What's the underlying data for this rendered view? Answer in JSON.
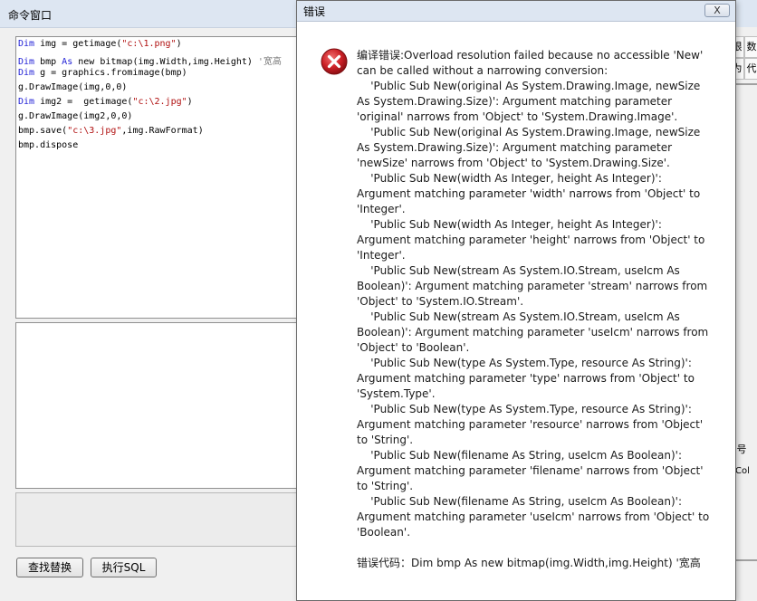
{
  "command_window": {
    "title": "命令窗口",
    "code_lines": [
      [
        "Dim",
        " img = getimage(",
        "\"c:\\1.png\"",
        ")",
        ""
      ],
      [
        "Dim",
        " bmp ",
        "As",
        " new bitmap(img.Width,img.Height)",
        " '宽高"
      ],
      [
        "Dim",
        " g = graphics.fromimage(bmp)",
        "",
        "",
        ""
      ],
      [
        "",
        "g.DrawImage(img,0,0)",
        "",
        "",
        ""
      ],
      [
        "Dim",
        " img2 =  getimage(",
        "\"c:\\2.jpg\"",
        ")",
        ""
      ],
      [
        "",
        "g.DrawImage(img2,0,0)",
        "",
        "",
        ""
      ],
      [
        "",
        "bmp.save(",
        "\"c:\\3.jpg\"",
        ",img.RawFormat)",
        ""
      ],
      [
        "",
        "bmp.dispose",
        "",
        "",
        ""
      ]
    ],
    "find_replace_label": "查找替换",
    "run_sql_label": "执行SQL",
    "right_strip": [
      "限",
      "数",
      "为",
      "代",
      "号",
      "Col"
    ]
  },
  "dialog": {
    "title": "错误",
    "close_label": "X",
    "message_lines": [
      "编译错误:Overload resolution failed because no accessible 'New'",
      "can be called without a narrowing conversion:",
      "    'Public Sub New(original As System.Drawing.Image, newSize",
      "As System.Drawing.Size)': Argument matching parameter",
      "'original' narrows from 'Object' to 'System.Drawing.Image'.",
      "    'Public Sub New(original As System.Drawing.Image, newSize",
      "As System.Drawing.Size)': Argument matching parameter",
      "'newSize' narrows from 'Object' to 'System.Drawing.Size'.",
      "    'Public Sub New(width As Integer, height As Integer)':",
      "Argument matching parameter 'width' narrows from 'Object' to",
      "'Integer'.",
      "    'Public Sub New(width As Integer, height As Integer)':",
      "Argument matching parameter 'height' narrows from 'Object' to",
      "'Integer'.",
      "    'Public Sub New(stream As System.IO.Stream, useIcm As",
      "Boolean)': Argument matching parameter 'stream' narrows from",
      "'Object' to 'System.IO.Stream'.",
      "    'Public Sub New(stream As System.IO.Stream, useIcm As",
      "Boolean)': Argument matching parameter 'useIcm' narrows from",
      "'Object' to 'Boolean'.",
      "    'Public Sub New(type As System.Type, resource As String)':",
      "Argument matching parameter 'type' narrows from 'Object' to",
      "'System.Type'.",
      "    'Public Sub New(type As System.Type, resource As String)':",
      "Argument matching parameter 'resource' narrows from 'Object'",
      "to 'String'.",
      "    'Public Sub New(filename As String, useIcm As Boolean)':",
      "Argument matching parameter 'filename' narrows from 'Object'",
      "to 'String'.",
      "    'Public Sub New(filename As String, useIcm As Boolean)':",
      "Argument matching parameter 'useIcm' narrows from 'Object' to",
      "'Boolean'."
    ],
    "error_code_line": "错误代码：Dim bmp As new bitmap(img.Width,img.Height) '宽高",
    "icon": "error-x-icon",
    "icon_color": "#c8202a"
  }
}
